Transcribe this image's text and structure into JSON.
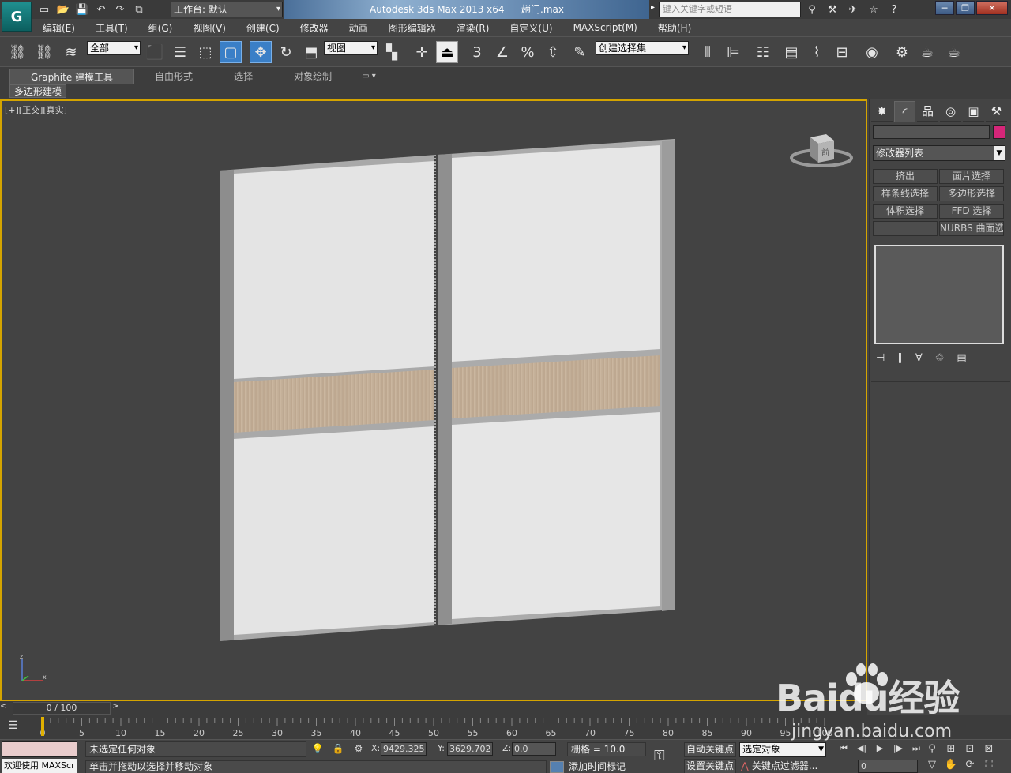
{
  "app": {
    "logo_glyph": "G",
    "workspace_label": "工作台: 默认",
    "title_app": "Autodesk 3ds Max  2013 x64",
    "title_file": "趟门.max",
    "search_placeholder": "键入关键字或短语",
    "window_min": "─",
    "window_max": "❐",
    "window_close": "✕"
  },
  "quick_access": [
    {
      "icon": "new-file-icon",
      "glyph": "▭"
    },
    {
      "icon": "open-file-icon",
      "glyph": "📂"
    },
    {
      "icon": "save-icon",
      "glyph": "💾"
    },
    {
      "icon": "undo-icon",
      "glyph": "↶"
    },
    {
      "icon": "redo-icon",
      "glyph": "↷"
    },
    {
      "icon": "project-folder-icon",
      "glyph": "⧉"
    }
  ],
  "info_tools": [
    {
      "icon": "binoculars-icon",
      "glyph": "⚲"
    },
    {
      "icon": "subscription-icon",
      "glyph": "⚒"
    },
    {
      "icon": "communication-icon",
      "glyph": "✈"
    },
    {
      "icon": "favorites-icon",
      "glyph": "☆"
    },
    {
      "icon": "help-icon",
      "glyph": "?"
    }
  ],
  "menu": [
    "编辑(E)",
    "工具(T)",
    "组(G)",
    "视图(V)",
    "创建(C)",
    "修改器",
    "动画",
    "图形编辑器",
    "渲染(R)",
    "自定义(U)",
    "MAXScript(M)",
    "帮助(H)"
  ],
  "toolbar": {
    "selection_filter": "全部",
    "reference_coord": "视图",
    "named_selection": "创建选择集"
  },
  "ribbon": {
    "tabs": [
      "Graphite 建模工具",
      "自由形式",
      "选择",
      "对象绘制"
    ],
    "dropdown_glyph": "▭ ▾",
    "panel_label": "多边形建模"
  },
  "viewport": {
    "label": "[+][正交][真实]",
    "viewcube_face": "前",
    "border_color": "#d4a400",
    "axis_x": "x",
    "axis_z": "z"
  },
  "command_panel": {
    "tabs": [
      {
        "icon": "create-icon",
        "glyph": "✸"
      },
      {
        "icon": "modify-icon",
        "glyph": "◜"
      },
      {
        "icon": "hierarchy-icon",
        "glyph": "品"
      },
      {
        "icon": "motion-icon",
        "glyph": "◎"
      },
      {
        "icon": "display-icon",
        "glyph": "▣"
      },
      {
        "icon": "utilities-icon",
        "glyph": "⚒"
      }
    ],
    "object_color": "#d62679",
    "modifier_list": "修改器列表",
    "modifier_buttons": [
      "挤出",
      "面片选择",
      "样条线选择",
      "多边形选择",
      "体积选择",
      "FFD 选择",
      "",
      "NURBS 曲面选择"
    ],
    "stack_tools": [
      {
        "icon": "pin-stack-icon",
        "glyph": "⊣"
      },
      {
        "icon": "show-end-result-icon",
        "glyph": "∥"
      },
      {
        "icon": "make-unique-icon",
        "glyph": "∀"
      },
      {
        "icon": "remove-modifier-icon",
        "glyph": "♲"
      },
      {
        "icon": "configure-modifier-sets-icon",
        "glyph": "▤"
      }
    ]
  },
  "time_slider": {
    "position": "0 / 100",
    "prev": "<",
    "next": ">"
  },
  "trackbar": {
    "ticks": [
      "0",
      "5",
      "10",
      "15",
      "20",
      "25",
      "30",
      "35",
      "40",
      "45",
      "50",
      "55",
      "60",
      "65",
      "70",
      "75",
      "80",
      "85",
      "90",
      "95",
      "100"
    ],
    "current_frame": 0
  },
  "status": {
    "maxscript_label": "欢迎使用 MAXScr",
    "selection_status": "未选定任何对象",
    "prompt": "单击并拖动以选择并移动对象",
    "x_label": "X:",
    "x_value": "9429.325",
    "y_label": "Y:",
    "y_value": "3629.702",
    "z_label": "Z:",
    "z_value": "0.0",
    "grid": "栅格 = 10.0",
    "add_time_tag": "添加时间标记",
    "auto_key": "自动关键点",
    "set_key": "设置关键点",
    "selected_object": "选定对象",
    "key_filters": "关键点过滤器...",
    "frame_value": "0"
  },
  "playback": [
    {
      "icon": "go-to-start-icon",
      "glyph": "⏮"
    },
    {
      "icon": "prev-frame-icon",
      "glyph": "◀|"
    },
    {
      "icon": "play-icon",
      "glyph": "▶"
    },
    {
      "icon": "next-frame-icon",
      "glyph": "|▶"
    },
    {
      "icon": "go-to-end-icon",
      "glyph": "⏭"
    }
  ],
  "nav_tools": [
    {
      "icon": "zoom-icon",
      "glyph": "⚲"
    },
    {
      "icon": "zoom-all-icon",
      "glyph": "⊞"
    },
    {
      "icon": "zoom-extents-icon",
      "glyph": "⊡"
    },
    {
      "icon": "zoom-extents-all-icon",
      "glyph": "⊠"
    },
    {
      "icon": "field-of-view-icon",
      "glyph": "▽"
    },
    {
      "icon": "pan-icon",
      "glyph": "✋"
    },
    {
      "icon": "orbit-icon",
      "glyph": "⟳"
    },
    {
      "icon": "maximize-viewport-icon",
      "glyph": "⛶"
    }
  ],
  "watermark": {
    "brand": "Baidu经验",
    "url": "jingyan.baidu.com"
  }
}
